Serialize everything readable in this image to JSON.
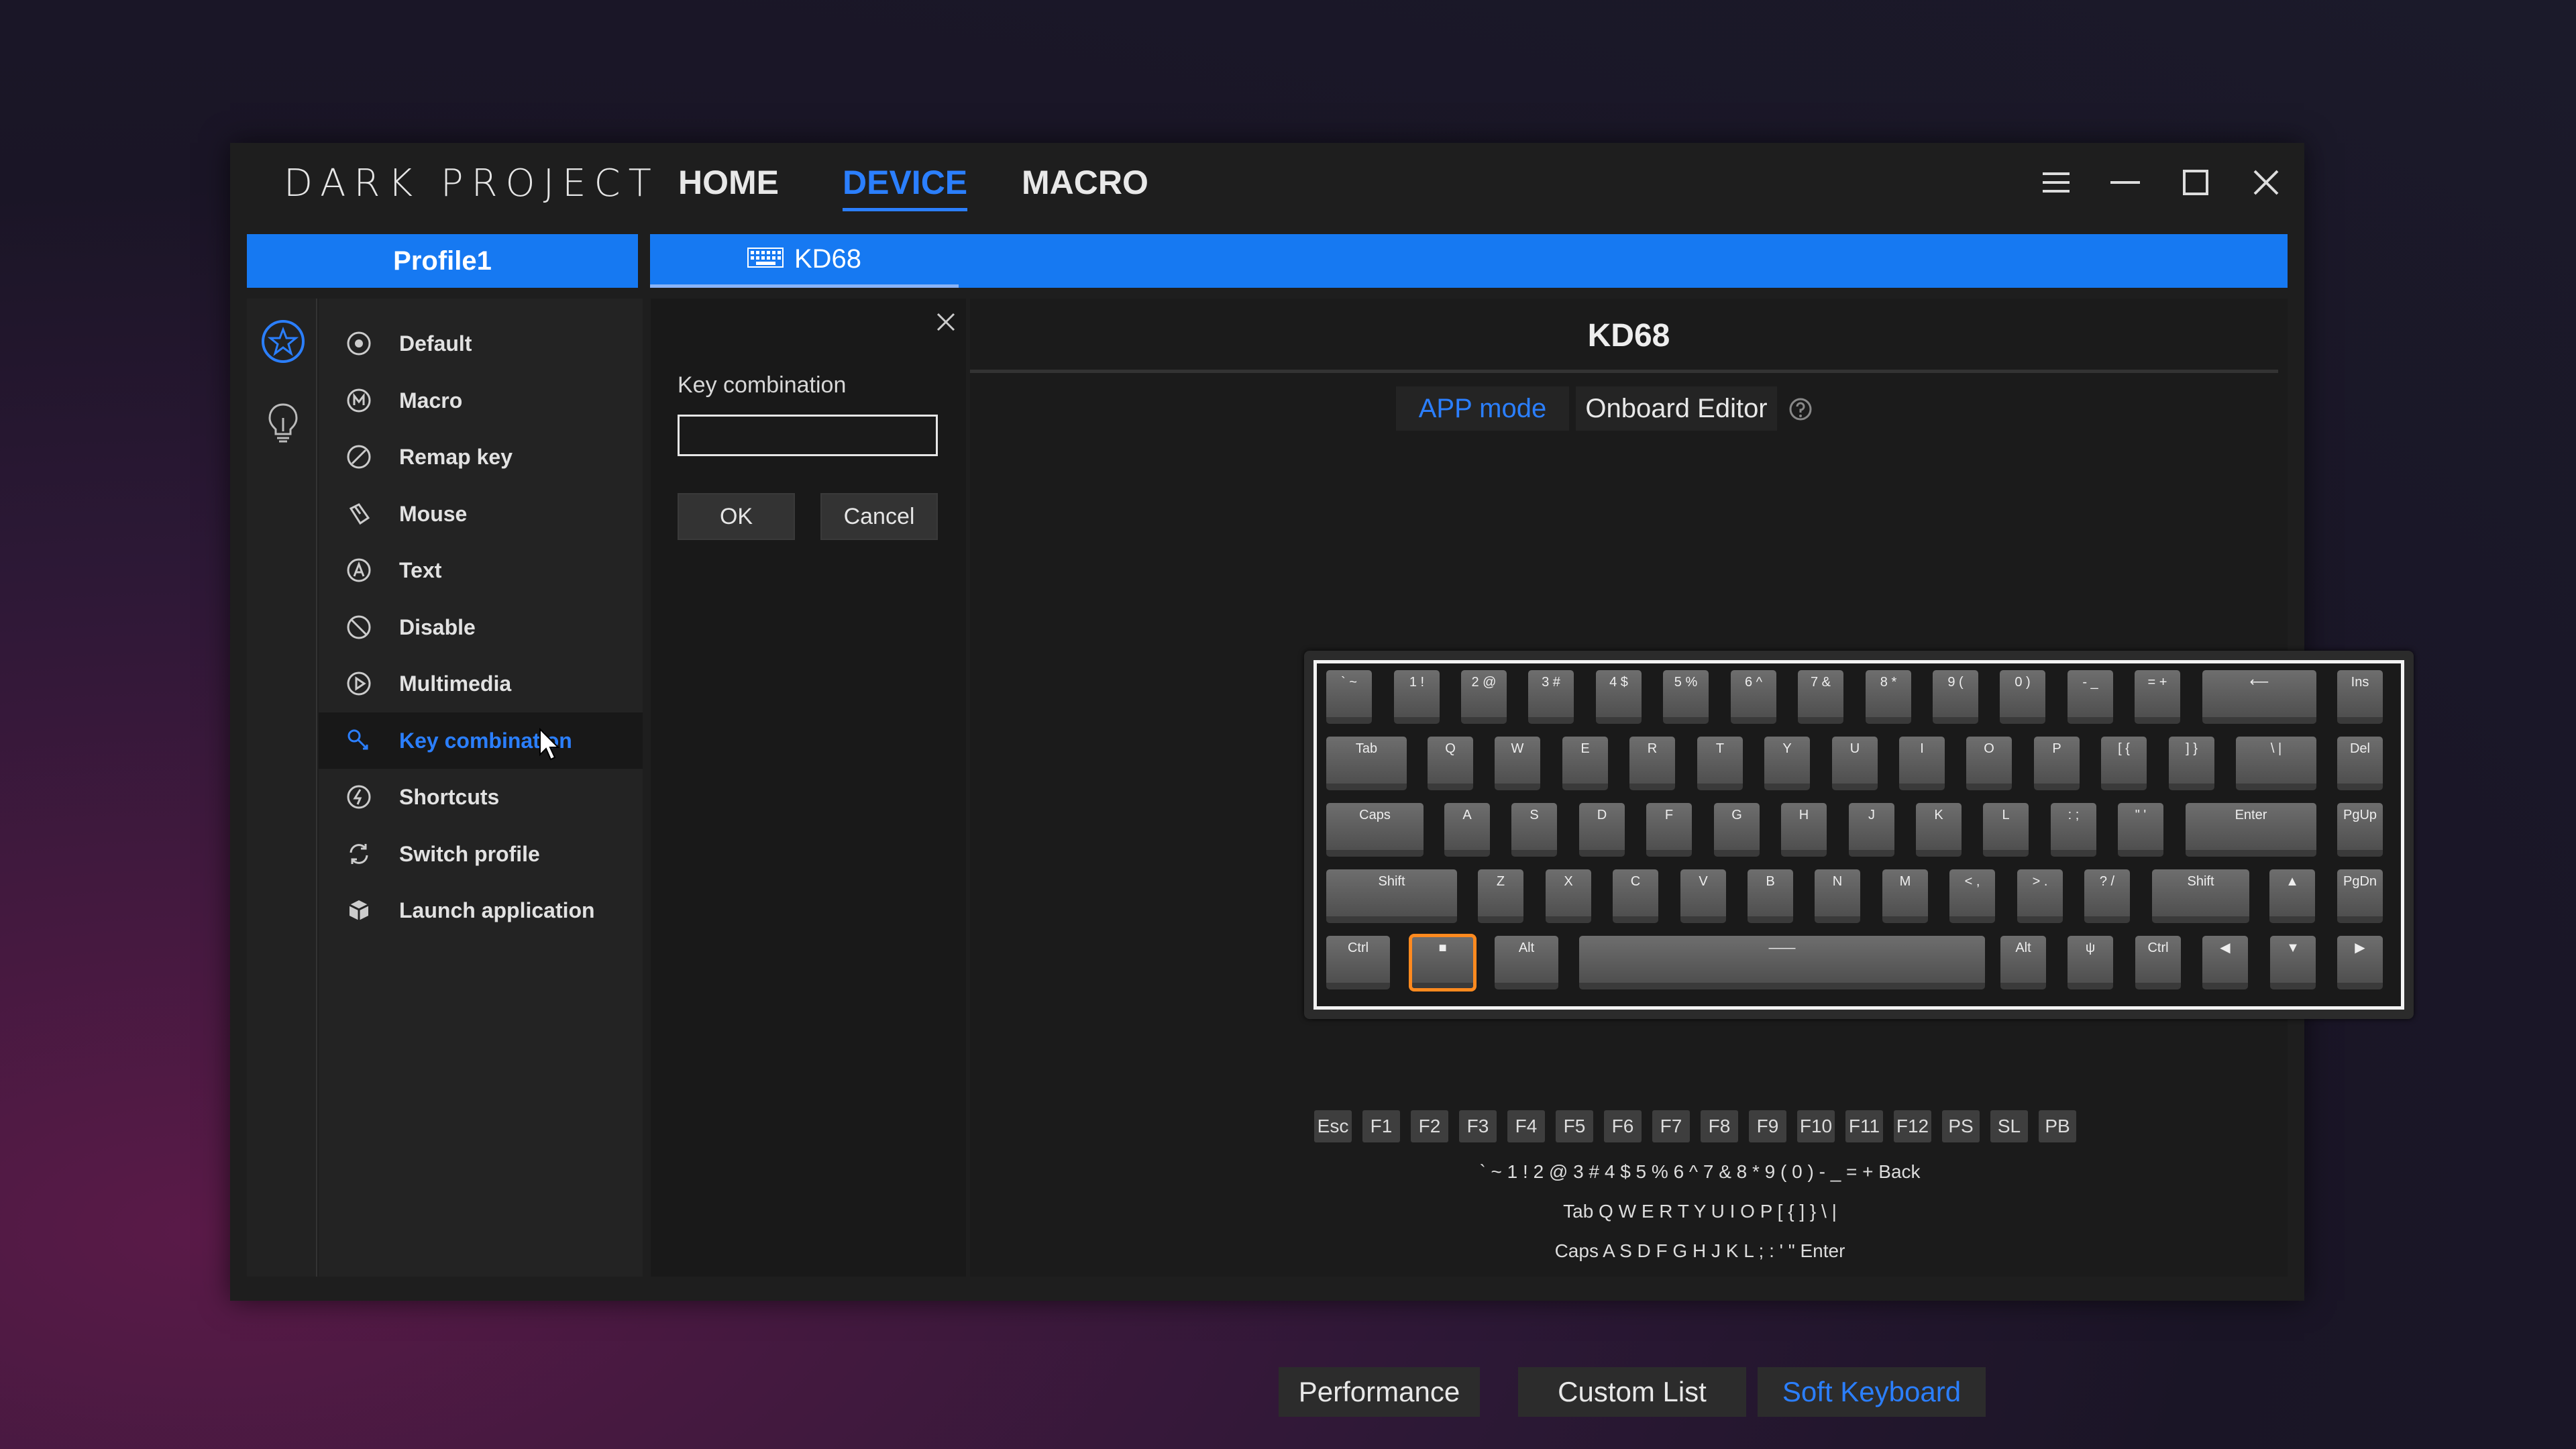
{
  "app": {
    "brand": "DARK PROJECT",
    "nav": [
      "HOME",
      "DEVICE",
      "MACRO"
    ],
    "active_nav": "DEVICE"
  },
  "profile": {
    "name": "Profile1"
  },
  "device": {
    "tab": "KD68",
    "title": "KD68"
  },
  "menu": {
    "items": [
      "Default",
      "Macro",
      "Remap key",
      "Mouse",
      "Text",
      "Disable",
      "Multimedia",
      "Key combination",
      "Shortcuts",
      "Switch profile",
      "Launch application"
    ],
    "selected": "Key combination"
  },
  "dialog": {
    "label": "Key combination",
    "value": "",
    "ok": "OK",
    "cancel": "Cancel"
  },
  "mode": {
    "app": "APP mode",
    "onboard": "Onboard Editor"
  },
  "keyboard": {
    "highlighted_key": "win"
  },
  "soft_keyboard": {
    "fn": [
      "Esc",
      "F1",
      "F2",
      "F3",
      "F4",
      "F5",
      "F6",
      "F7",
      "F8",
      "F9",
      "F10",
      "F11",
      "F12",
      "PS",
      "SL",
      "PB"
    ]
  },
  "bottom_tabs": [
    "Performance",
    "Custom List",
    "Soft Keyboard"
  ],
  "bottom_active": "Soft Keyboard",
  "colors": {
    "accent": "#1679f2",
    "highlight": "#ff8a1f"
  }
}
